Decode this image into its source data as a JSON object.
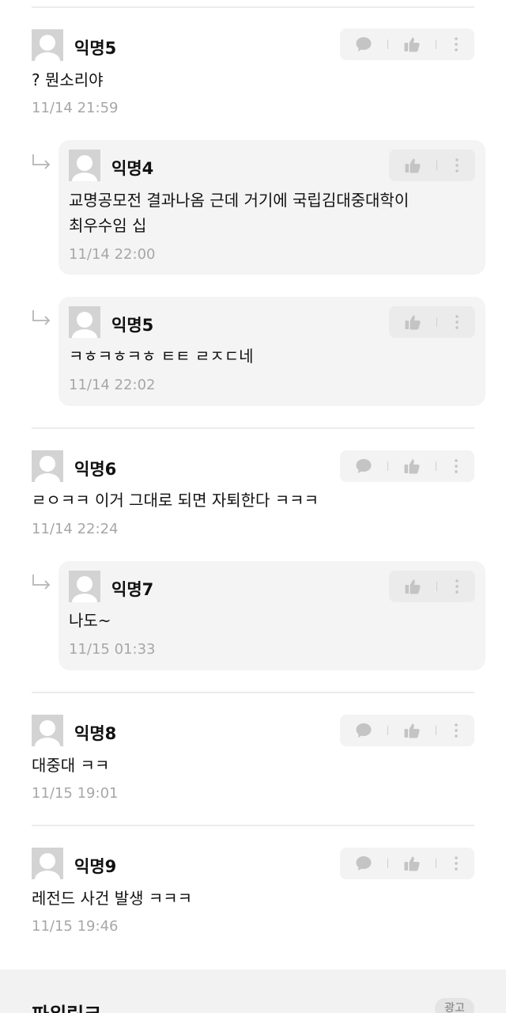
{
  "comments": [
    {
      "name": "익명5",
      "text": "? 뭔소리야",
      "time": "11/14 21:59"
    },
    {
      "name": "익명4",
      "lines": [
        "교명공모전 결과나옴 근데 거기에 국립김대중대학이",
        "최우수임 십"
      ],
      "time": "11/14 22:00"
    },
    {
      "name": "익명5",
      "text": "ㅋㅎㅋㅎㅋㅎ ㅌㅌ ㄹㅈㄷ네",
      "time": "11/14 22:02"
    },
    {
      "name": "익명6",
      "text": "ㄹㅇㅋㅋ 이거 그대로 되면 자퇴한다 ㅋㅋㅋ",
      "time": "11/14 22:24"
    },
    {
      "name": "익명7",
      "text": "나도~",
      "time": "11/15 01:33"
    },
    {
      "name": "익명8",
      "text": "대중대 ㅋㅋ",
      "time": "11/15 19:01"
    },
    {
      "name": "익명9",
      "text": "레전드 사건 발생 ㅋㅋㅋ",
      "time": "11/15 19:46"
    }
  ],
  "footer": {
    "title": "파워링크",
    "ad_badge": "광고"
  },
  "icons": {
    "reply": "speech-bubble-icon",
    "like": "thumbs-up-icon",
    "more": "more-vertical-icon",
    "nested": "reply-arrow-icon"
  },
  "colors": {
    "avatar": "#d3d3d3",
    "icon": "#c4c4c4",
    "time": "#a7a7a7",
    "card": "#f4f4f4"
  }
}
